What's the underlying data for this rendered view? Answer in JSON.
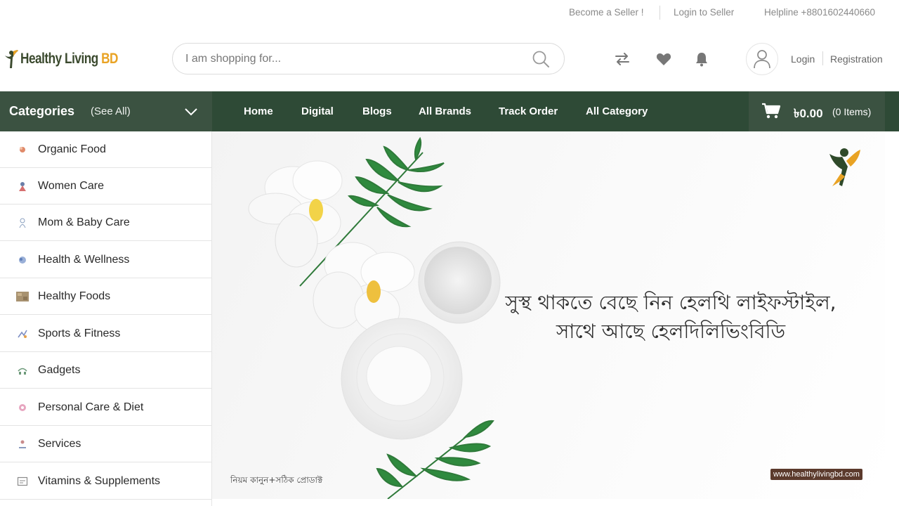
{
  "topbar": {
    "become_seller": "Become a Seller !",
    "login_seller": "Login to Seller",
    "helpline": "Helpline +8801602440660"
  },
  "header": {
    "logo_main": "Healthy Living ",
    "logo_accent": "BD",
    "search_placeholder": "I am shopping for...",
    "login": "Login",
    "registration": "Registration"
  },
  "nav": {
    "categories_title": "Categories",
    "see_all": "(See All)",
    "links": [
      "Home",
      "Digital",
      "Blogs",
      "All Brands",
      "Track Order",
      "All Category"
    ],
    "cart_amount": "৳0.00",
    "cart_items": "(0 Items)"
  },
  "sidebar": {
    "items": [
      {
        "label": "Organic Food",
        "icon": "organic-food-icon"
      },
      {
        "label": "Women Care",
        "icon": "women-care-icon"
      },
      {
        "label": "Mom & Baby Care",
        "icon": "baby-care-icon"
      },
      {
        "label": "Health & Wellness",
        "icon": "wellness-icon"
      },
      {
        "label": "Healthy Foods",
        "icon": "healthy-foods-icon"
      },
      {
        "label": "Sports & Fitness",
        "icon": "fitness-icon"
      },
      {
        "label": "Gadgets",
        "icon": "gadgets-icon"
      },
      {
        "label": "Personal Care & Diet",
        "icon": "personal-care-icon"
      },
      {
        "label": "Services",
        "icon": "services-icon"
      },
      {
        "label": "Vitamins & Supplements",
        "icon": "vitamins-icon"
      }
    ]
  },
  "banner": {
    "line1": "সুস্থ থাকতে বেছে নিন হেলথি লাইফস্টাইল,",
    "line2": "সাথে আছে হেলদিলিভিংবিডি",
    "tagline": "নিয়ম কানুন+সঠিক প্রোডাক্ট",
    "url": "www.healthylivingbd.com"
  },
  "colors": {
    "nav_bg": "#2e4a36",
    "nav_panel": "#3b5241",
    "logo_accent": "#e9a324",
    "logo_text": "#3b4a2e"
  }
}
